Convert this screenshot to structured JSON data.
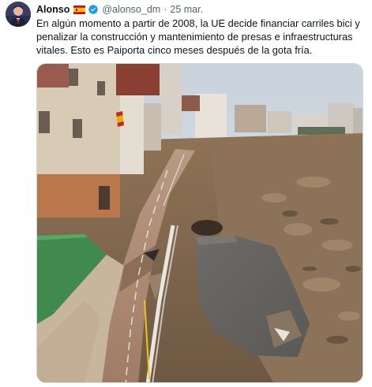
{
  "tweet": {
    "author": {
      "name": "Alonso",
      "handle": "@alonso_dm",
      "flag": "spain-flag-icon",
      "verified": "verified-badge-icon"
    },
    "separator": "·",
    "date": "25 mar.",
    "more_icon": "more-options-icon",
    "text_lines": [
      "En algún momento a partir de 2008, la UE decide financiar carriles bici y",
      "penalizar la construcción y mantenimiento de presas e infraestructuras",
      "vitales. Esto es Paiporta cinco meses después de la gota fría."
    ],
    "media": {
      "type": "photo",
      "description_icon": "photo-flood-damaged-bike-lane"
    }
  },
  "colors": {
    "text": "#0f1419",
    "secondary": "#536471",
    "verified": "#1d9bf0",
    "border": "#cfd9de"
  }
}
